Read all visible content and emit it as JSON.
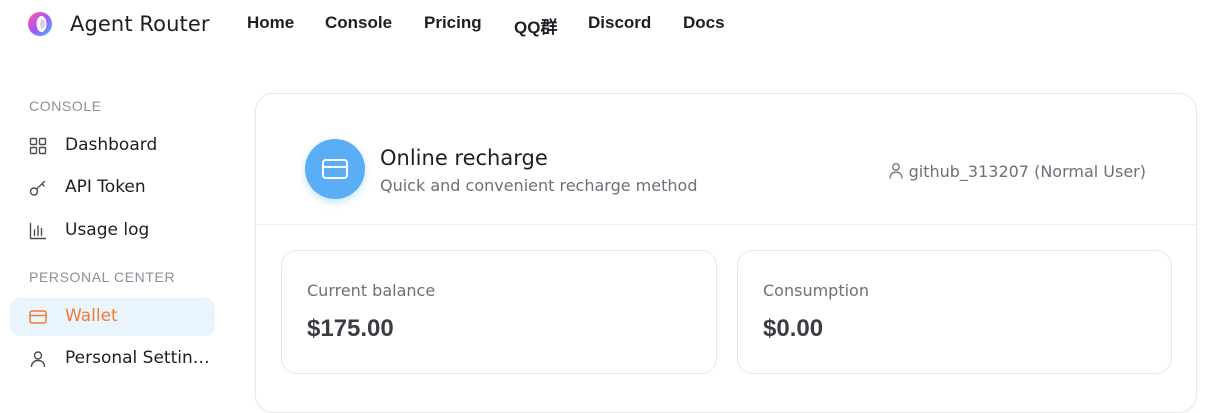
{
  "app": {
    "brand": "Agent Router",
    "logo_icon": "agent-router-logo"
  },
  "nav": {
    "items": [
      {
        "label": "Home"
      },
      {
        "label": "Console"
      },
      {
        "label": "Pricing"
      },
      {
        "label": "QQ群"
      },
      {
        "label": "Discord"
      },
      {
        "label": "Docs"
      }
    ]
  },
  "sidebar": {
    "console_section": "CONSOLE",
    "personal_section": "PERSONAL CENTER",
    "items": [
      {
        "label": "Dashboard",
        "icon": "dashboard-grid-icon"
      },
      {
        "label": "API Token",
        "icon": "key-icon"
      },
      {
        "label": "Usage log",
        "icon": "bar-chart-icon"
      },
      {
        "label": "Wallet",
        "icon": "wallet-icon",
        "active": true
      },
      {
        "label": "Personal Settings",
        "icon": "user-icon"
      }
    ]
  },
  "recharge": {
    "title": "Online recharge",
    "subtitle": "Quick and convenient recharge method",
    "icon": "credit-card-icon",
    "user": "github_313207 (Normal User)"
  },
  "stats": {
    "balance_label": "Current balance",
    "balance_value": "$175.00",
    "consumption_label": "Consumption",
    "consumption_value": "$0.00"
  },
  "colors": {
    "accent_orange": "#f07a36",
    "active_bg": "#eaf4fd",
    "badge_blue": "#5aaef5"
  }
}
